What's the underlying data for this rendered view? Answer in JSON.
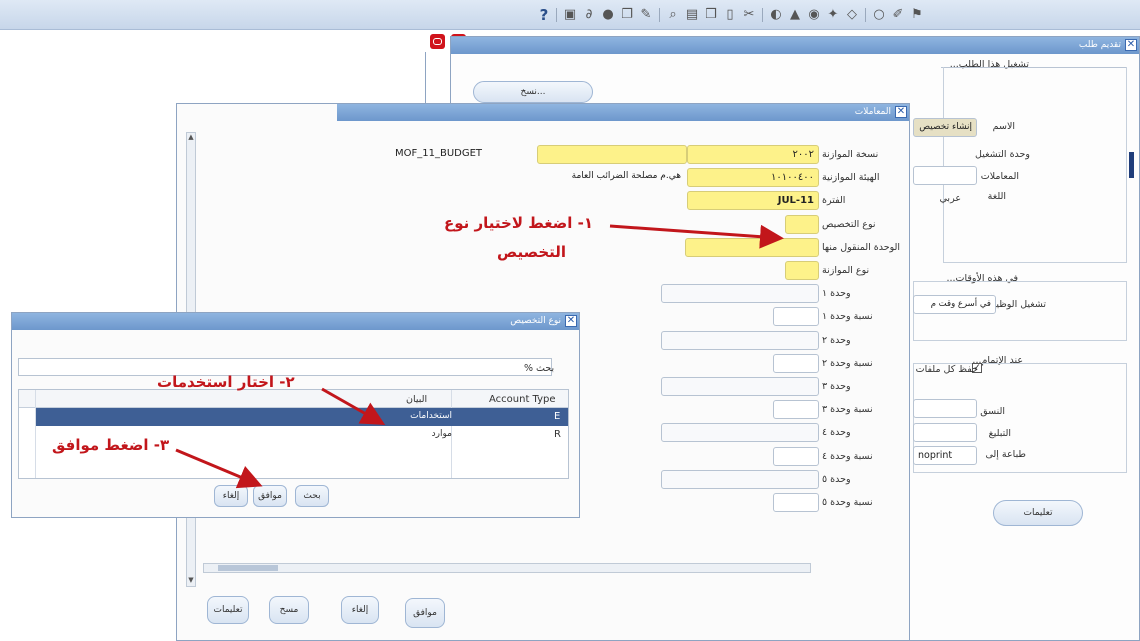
{
  "toolbar": {
    "help_glyph": "?",
    "icons": [
      "folder-icon",
      "paperclip-icon",
      "globe-icon",
      "window-icon",
      "edit-icon",
      "sep",
      "zoom-icon",
      "image-icon",
      "copy-icon",
      "paste-icon",
      "cut-icon",
      "sep",
      "translate-icon",
      "print-icon",
      "record-icon",
      "clear-icon",
      "eraser-icon",
      "sep",
      "navigator-icon",
      "pin-icon",
      "flag-icon"
    ]
  },
  "request_window": {
    "title": "تقديم طلب",
    "section_run": "تشغيل هذا الطلب...",
    "copy_button": "نسخ...",
    "name_label": "الاسم",
    "name_value": "إنشاء تخصيص",
    "op_unit_label": "وحدة التشغيل",
    "params_label": "المعاملات",
    "language_label": "اللغة",
    "language_value": "عربي",
    "section_times": "في هذه الأوقات...",
    "run_job_label": "تشغيل الوظيفة",
    "run_job_value": "في أسرع وقت م",
    "section_completion": "عند الإتمام...",
    "save_files_label": "حفظ كل ملفات",
    "layout_label": "النسق",
    "notify_label": "التبليغ",
    "print_to_label": "طباعة إلى",
    "print_to_value": "noprint",
    "options_button": "تعليمات"
  },
  "params_window": {
    "title": "المعاملات",
    "rows": [
      {
        "label": "نسخة الموازنة",
        "value": "٢٠٠٢",
        "desc": "MOF_11_BUDGET",
        "style": "yellow"
      },
      {
        "label": "الهيئة الموازنية",
        "value": "١٠١٠٠٤٠٠",
        "desc": "هي.م مصلحة الضرائب العامة",
        "style": "yellow"
      },
      {
        "label": "الفترة",
        "value": "JUL-11",
        "desc": "",
        "style": "yellow"
      },
      {
        "label": "نوع التخصيص",
        "value": "",
        "desc": "",
        "style": "yellow"
      },
      {
        "label": "الوحدة المنقول منها",
        "value": "",
        "desc": "",
        "style": "yellow"
      },
      {
        "label": "نوع الموازنة",
        "value": "",
        "desc": "",
        "style": "yellow"
      },
      {
        "label": "وحدة ١",
        "value": "",
        "desc": "",
        "style": "white"
      },
      {
        "label": "نسبة وحدة ١",
        "value": "",
        "desc": "",
        "style": "white"
      },
      {
        "label": "وحدة ٢",
        "value": "",
        "desc": "",
        "style": "white"
      },
      {
        "label": "نسبة وحدة ٢",
        "value": "",
        "desc": "",
        "style": "white"
      },
      {
        "label": "وحدة ٣",
        "value": "",
        "desc": "",
        "style": "white"
      },
      {
        "label": "نسبة وحدة ٣",
        "value": "",
        "desc": "",
        "style": "white"
      },
      {
        "label": "وحدة ٤",
        "value": "",
        "desc": "",
        "style": "white"
      },
      {
        "label": "نسبة وحدة ٤",
        "value": "",
        "desc": "",
        "style": "white"
      },
      {
        "label": "وحدة ٥",
        "value": "",
        "desc": "",
        "style": "white"
      },
      {
        "label": "نسبة وحدة ٥",
        "value": "",
        "desc": "",
        "style": "white"
      }
    ],
    "buttons": {
      "ok": "موافق",
      "cancel": "إلغاء",
      "clear": "مسح",
      "help": "تعليمات"
    }
  },
  "lov_window": {
    "title": "نوع التخصيص",
    "search_label": "بحث",
    "search_value": "%",
    "col_type": "Account Type",
    "col_desc": "البيان",
    "rows": [
      {
        "type": "E",
        "desc": "استخدامات",
        "selected": true
      },
      {
        "type": "R",
        "desc": "موارد",
        "selected": false
      }
    ],
    "buttons": {
      "find": "بحث",
      "ok": "موافق",
      "cancel": "إلغاء"
    }
  },
  "annotations": {
    "step1_line1": "١- اضغط لاختيار نوع",
    "step1_line2": "التخصيص",
    "step2": "٢- اختار استخدمات",
    "step3": "٣- اضغط موافق"
  },
  "colors": {
    "annotation": "#c2161b",
    "field_required": "#fdf28a",
    "selected_row": "#3e5f95",
    "title_bar": "#6d97cc"
  }
}
